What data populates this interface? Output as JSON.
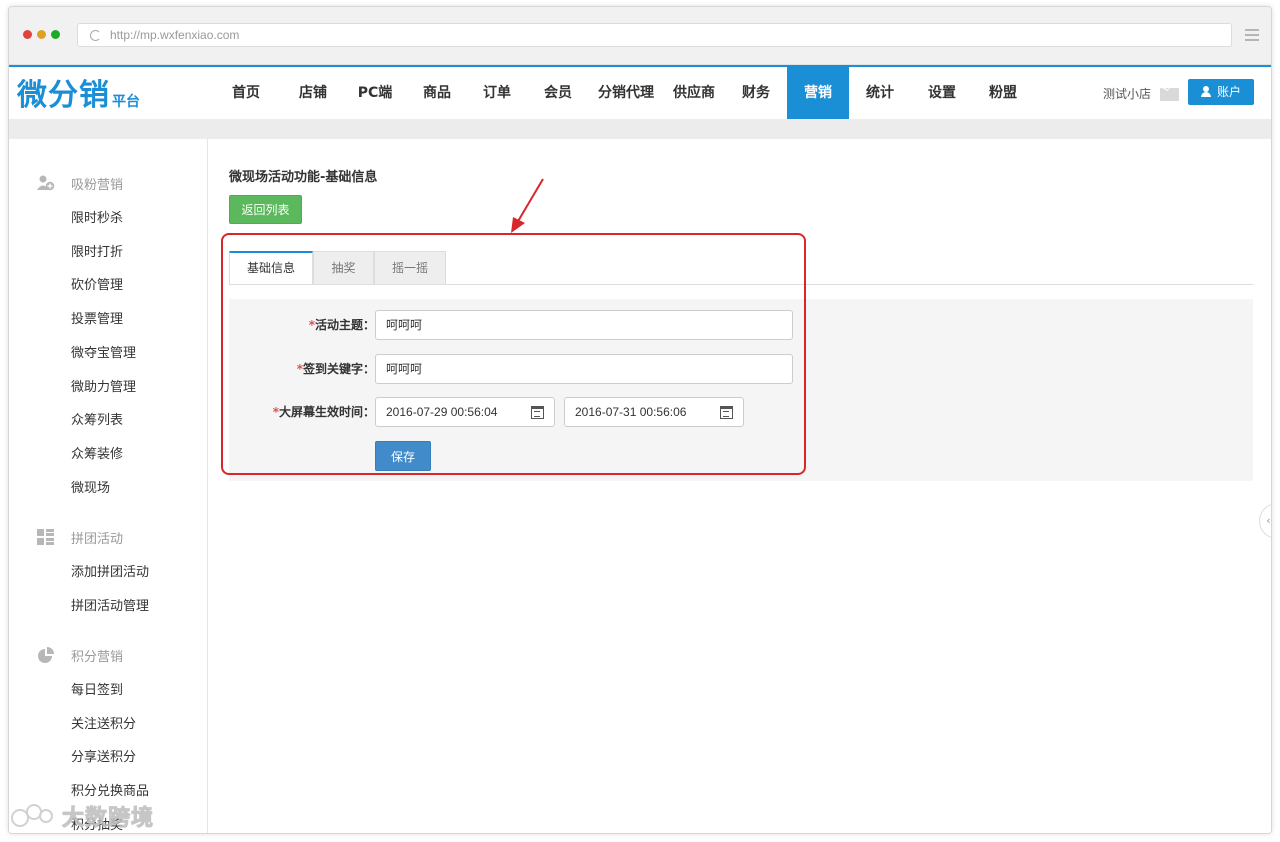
{
  "browser": {
    "url": "http://mp.wxfenxiao.com",
    "dot_colors": [
      "#e0443e",
      "#dea123",
      "#1aab29"
    ]
  },
  "brand": {
    "logo_main": "微分销",
    "logo_sub": "平台",
    "accent_color": "#1b8fd6"
  },
  "nav": {
    "items": [
      {
        "label": "首页",
        "active": false
      },
      {
        "label": "店铺",
        "active": false
      },
      {
        "label": "PC端",
        "active": false
      },
      {
        "label": "商品",
        "active": false
      },
      {
        "label": "订单",
        "active": false
      },
      {
        "label": "会员",
        "active": false
      },
      {
        "label": "分销代理",
        "active": false
      },
      {
        "label": "供应商",
        "active": false
      },
      {
        "label": "财务",
        "active": false
      },
      {
        "label": "营销",
        "active": true
      },
      {
        "label": "统计",
        "active": false
      },
      {
        "label": "设置",
        "active": false
      },
      {
        "label": "粉盟",
        "active": false
      }
    ],
    "shop_name": "测试小店",
    "account_label": "账户"
  },
  "sidebar": {
    "groups": [
      {
        "title": "吸粉营销",
        "icon": "user-add-icon",
        "items": [
          "限时秒杀",
          "限时打折",
          "砍价管理",
          "投票管理",
          "微夺宝管理",
          "微助力管理",
          "众筹列表",
          "众筹装修",
          "微现场"
        ]
      },
      {
        "title": "拼团活动",
        "icon": "grid-icon",
        "items": [
          "添加拼团活动",
          "拼团活动管理"
        ]
      },
      {
        "title": "积分营销",
        "icon": "pie-chart-icon",
        "items": [
          "每日签到",
          "关注送积分",
          "分享送积分",
          "积分兑换商品",
          "积分抽奖"
        ]
      }
    ]
  },
  "main": {
    "page_title": "微现场活动功能-基础信息",
    "back_label": "返回列表",
    "tabs": [
      {
        "label": "基础信息",
        "active": true
      },
      {
        "label": "抽奖",
        "active": false
      },
      {
        "label": "摇一摇",
        "active": false
      }
    ],
    "form": {
      "required_mark": "*",
      "topic_label": "活动主题：",
      "topic_value": "呵呵呵",
      "keyword_label": "签到关键字：",
      "keyword_value": "呵呵呵",
      "time_label": "大屏幕生效时间：",
      "start_time": "2016-07-29 00:56:04",
      "end_time": "2016-07-31 00:56:06",
      "save_label": "保存"
    }
  },
  "watermark": {
    "text": "大数跨境"
  }
}
